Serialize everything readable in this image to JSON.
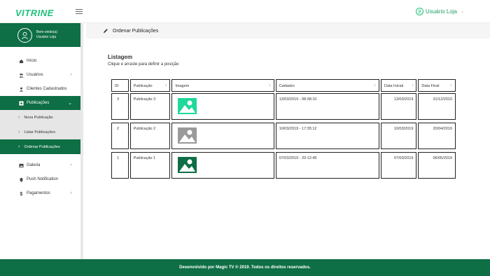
{
  "app": {
    "logo": "VITRINE"
  },
  "header": {
    "user_name": "Usuário Loja"
  },
  "profile": {
    "welcome": "Bem-vindo(a)",
    "name": "Usuário Loja"
  },
  "sidebar": {
    "items": [
      {
        "label": "Início",
        "icon": "home-icon"
      },
      {
        "label": "Usuários",
        "icon": "users-icon",
        "chevron": "‹"
      },
      {
        "label": "Clientes Cadastrados",
        "icon": "user-icon"
      },
      {
        "label": "Publicações",
        "icon": "plus-square-icon",
        "chevron": "⌄"
      }
    ],
    "submenu": [
      {
        "label": "Nova Publicação"
      },
      {
        "label": "Listar Publicações"
      },
      {
        "label": "Ordenar Publicações"
      }
    ],
    "items_after": [
      {
        "label": "Galeria",
        "icon": "image-icon",
        "chevron": "‹"
      },
      {
        "label": "Push Notification",
        "icon": "bell-icon"
      },
      {
        "label": "Pagamentos",
        "icon": "dollar-icon",
        "chevron": "‹"
      }
    ]
  },
  "breadcrumb": {
    "title": "Ordenar Publicações"
  },
  "listing": {
    "title": "Listagem",
    "subtitle": "Clique e arraste para definir a posição",
    "columns": [
      "ID",
      "Publicação",
      "Imagem",
      "Cadastro",
      "Data Inicial",
      "Data Final"
    ],
    "sort_glyph": "↕",
    "rows": [
      {
        "id": "3",
        "name": "Publicação 3",
        "thumb_color": "#1fd89a",
        "created": "13/03/2019 - 08:38:10",
        "start": "13/03/2019",
        "end": "31/12/2019"
      },
      {
        "id": "2",
        "name": "Publicação 2",
        "thumb_color": "#9a9a9a",
        "created": "10/03/2019 - 17:35:12",
        "start": "10/03/2019",
        "end": "20/04/2019"
      },
      {
        "id": "1",
        "name": "Publicação 1",
        "thumb_color": "#0e6e45",
        "created": "07/03/2019 - 20:12:45",
        "start": "07/03/2019",
        "end": "06/05/2019"
      }
    ]
  },
  "footer": {
    "text": "Desenvolvido por Magic TV ® 2019. Todos os direitos reservados."
  },
  "colors": {
    "brand": "#0e6e45",
    "accent": "#1fc27c"
  }
}
